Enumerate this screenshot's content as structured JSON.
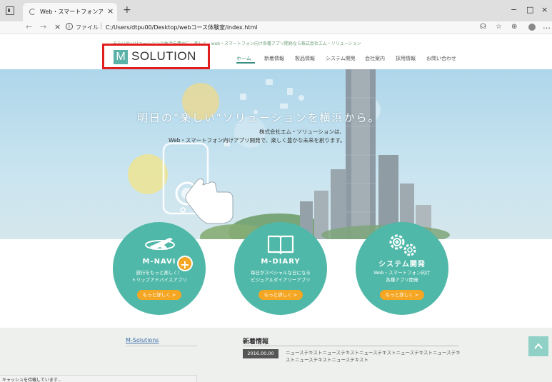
{
  "browser": {
    "tab_title": "Web・スマートフォンアプリ企業・製品",
    "tab_close": "×",
    "new_tab": "+",
    "win_min": "−",
    "win_max": "□",
    "win_close": "×",
    "nav_back": "←",
    "nav_forward": "→",
    "nav_stop": "×",
    "info": "i",
    "address_scheme": "ファイル",
    "address_url": "C:/Users/dtpu00/Desktop/webコース体験室/index.html",
    "status_text": "キャッシュを待機しています..."
  },
  "header": {
    "tagline": "みらいのソリューションで生活を豊かに、楽しく。web・スマートフォン向け各種アプリ開発なら株式会社エム・ソリューション",
    "logo_letter": "M",
    "logo_text": "SOLUTION",
    "nav": [
      "ホーム",
      "新着情報",
      "製品情報",
      "システム開発",
      "会社案内",
      "採用情報",
      "お問い合わせ"
    ]
  },
  "hero": {
    "headline": "明日の\"楽しい\"ソリューションを横浜から。",
    "sub1": "株式会社エム・ソリューションは、",
    "sub2": "Web・スマートフォン向けアプリ開発で、楽しく豊かな未来を創ります。"
  },
  "products": [
    {
      "name": "M-NAVI",
      "desc1": "旅行をもっと楽しく！",
      "desc2": "トリップアドバイスアプリ",
      "button": "もっと詳しく >"
    },
    {
      "name": "M-DIARY",
      "desc1": "毎日がスペシャルな日になる",
      "desc2": "ビジュアルダイアリーアプリ",
      "button": "もっと詳しく >"
    },
    {
      "name": "システム開発",
      "desc1": "Web・スマートフォン向け",
      "desc2": "各種アプリ開発",
      "button": "もっと詳しく >"
    }
  ],
  "footer": {
    "link": "M-Solutions",
    "news_heading": "新着情報",
    "news_date": "2016.00.00",
    "news_text": "ニューステキストニューステキストニューステキストニューステキストニューステキストニューステキストニューステキスト"
  },
  "colors": {
    "accent": "#4fb8a8",
    "button": "#f5a623",
    "highlight": "#e11d1d"
  },
  "icons": {
    "scroll_top": "chevron-up-icon",
    "plus_badge": "+"
  }
}
